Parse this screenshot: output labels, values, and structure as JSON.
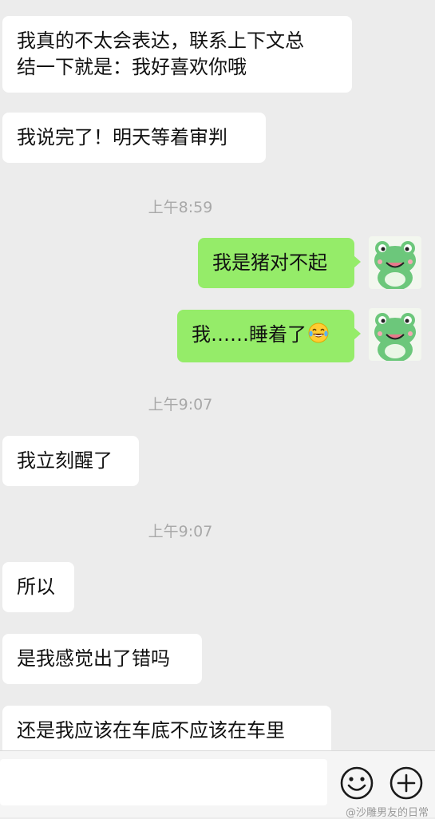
{
  "messages": {
    "m1_line1": "我真的不太会表达，联系上下文总",
    "m1_line2": "结一下就是：我好喜欢你哦",
    "m2": "我说完了！明天等着审判",
    "ts1": "上午8:59",
    "m3": "我是猪对不起",
    "m4": "我……睡着了",
    "ts2": "上午9:07",
    "m5": "我立刻醒了",
    "ts3": "上午9:07",
    "m6": "所以",
    "m7": "是我感觉出了错吗",
    "m8": "还是我应该在车底不应该在车里"
  },
  "input": {
    "value": "",
    "placeholder": ""
  },
  "icons": {
    "emoji_button": "smiley-face-icon",
    "more_button": "plus-circle-icon",
    "inline_emoji": "laughing-tears-emoji-icon",
    "avatar": "green-frog-avatar"
  },
  "watermark": "@沙雕男友的日常",
  "colors": {
    "background": "#ececec",
    "incoming_bubble": "#ffffff",
    "outgoing_bubble": "#95ec69",
    "timestamp": "#a8a8a8",
    "avatar_frog": "#6cc77b"
  }
}
